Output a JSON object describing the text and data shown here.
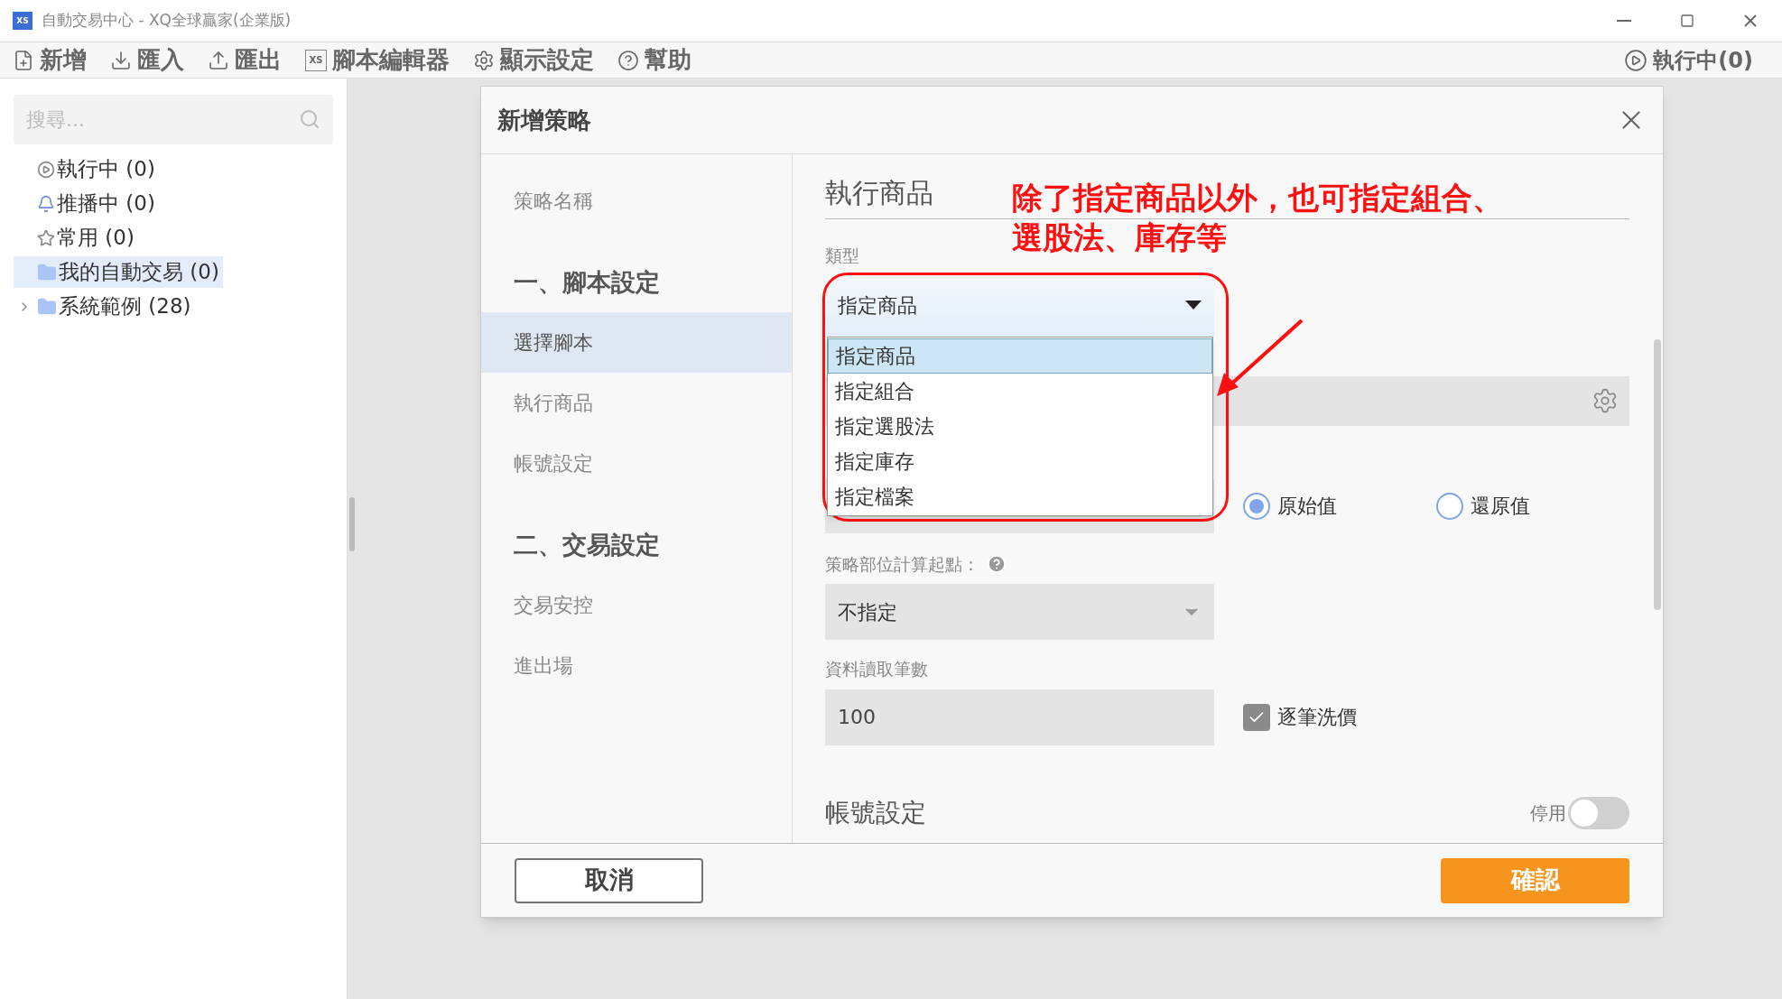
{
  "window": {
    "logo": "XS",
    "title": "自動交易中心 - XQ全球贏家(企業版)"
  },
  "toolbar": {
    "items": [
      {
        "kind": "new",
        "label": "新增"
      },
      {
        "kind": "import",
        "label": "匯入"
      },
      {
        "kind": "export",
        "label": "匯出"
      },
      {
        "kind": "editor",
        "label": "腳本編輯器",
        "icon_text": "XS"
      },
      {
        "kind": "settings",
        "label": "顯示設定"
      },
      {
        "kind": "help",
        "label": "幫助"
      }
    ],
    "status": "執行中(0)"
  },
  "sidebar": {
    "search": {
      "placeholder": "搜尋..."
    },
    "items": [
      {
        "kind": "running",
        "label": "執行中 (0)",
        "selected": false,
        "expandable": false
      },
      {
        "kind": "push",
        "label": "推播中 (0)",
        "selected": false,
        "expandable": false
      },
      {
        "kind": "favorite",
        "label": "常用 (0)",
        "selected": false,
        "expandable": false
      },
      {
        "kind": "folder",
        "label": "我的自動交易 (0)",
        "selected": true,
        "expandable": false
      },
      {
        "kind": "folder",
        "label": "系統範例 (28)",
        "selected": false,
        "expandable": true
      }
    ]
  },
  "dialog": {
    "title": "新增策略",
    "nav": [
      {
        "kind": "item",
        "label": "策略名稱",
        "selected": false
      },
      {
        "kind": "section",
        "label": "一、腳本設定",
        "selected": false
      },
      {
        "kind": "item",
        "label": "選擇腳本",
        "selected": true
      },
      {
        "kind": "item",
        "label": "執行商品",
        "selected": false
      },
      {
        "kind": "item",
        "label": "帳號設定",
        "selected": false
      },
      {
        "kind": "section",
        "label": "二、交易設定",
        "selected": false
      },
      {
        "kind": "item",
        "label": "交易安控",
        "selected": false
      },
      {
        "kind": "item",
        "label": "進出場",
        "selected": false
      }
    ],
    "section_title": "執行商品",
    "annotation": [
      "除了指定商品以外，也可指定組合、",
      "選股法、庫存等"
    ],
    "type_field": {
      "label": "類型",
      "value": "指定商品",
      "options": [
        {
          "label": "指定商品",
          "selected": true
        },
        {
          "label": "指定組合",
          "selected": false
        },
        {
          "label": "指定選股法",
          "selected": false
        },
        {
          "label": "指定庫存",
          "selected": false
        },
        {
          "label": "指定檔案",
          "selected": false
        }
      ]
    },
    "radios": [
      {
        "label": "原始值",
        "selected": true
      },
      {
        "label": "還原值",
        "selected": false
      }
    ],
    "position_field": {
      "label": "策略部位計算起點：",
      "value": "不指定"
    },
    "records_field": {
      "label": "資料讀取筆數",
      "value": "100"
    },
    "checkbox": {
      "label": "逐筆洗價",
      "checked": true
    },
    "account_section": {
      "title": "帳號設定",
      "toggle_label": "停用",
      "on": false
    },
    "buttons": {
      "cancel": "取消",
      "confirm": "確認"
    }
  }
}
